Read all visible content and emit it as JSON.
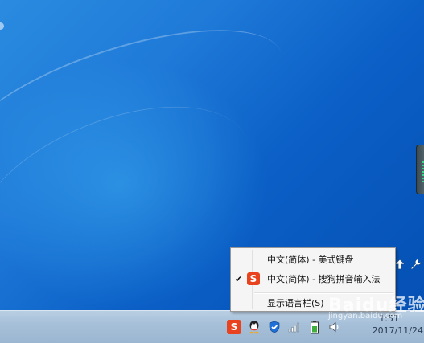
{
  "desktop": {
    "accent": "#1f7ad8"
  },
  "langbar_tools": [
    {
      "icon": "up-arrow-icon"
    },
    {
      "icon": "wrench-icon"
    }
  ],
  "context_menu": {
    "items": [
      {
        "label": "中文(简体) - 美式键盘",
        "checked": false,
        "icon": ""
      },
      {
        "label": "中文(简体) - 搜狗拼音输入法",
        "checked": true,
        "icon": "sogou-icon"
      },
      {
        "label": "显示语言栏(S)",
        "checked": false,
        "icon": ""
      }
    ],
    "check_glyph": "✔",
    "sogou_glyph": "S"
  },
  "taskbar": {
    "tray_icons": [
      "sogou-icon",
      "qq-icon",
      "shield-icon",
      "network-signal-icon",
      "battery-icon",
      "volume-icon"
    ],
    "clock": {
      "time": "1:51",
      "date": "2017/11/24"
    }
  },
  "watermark": {
    "brand": "Baidu经验",
    "url": "jingyan.baidu.com"
  }
}
